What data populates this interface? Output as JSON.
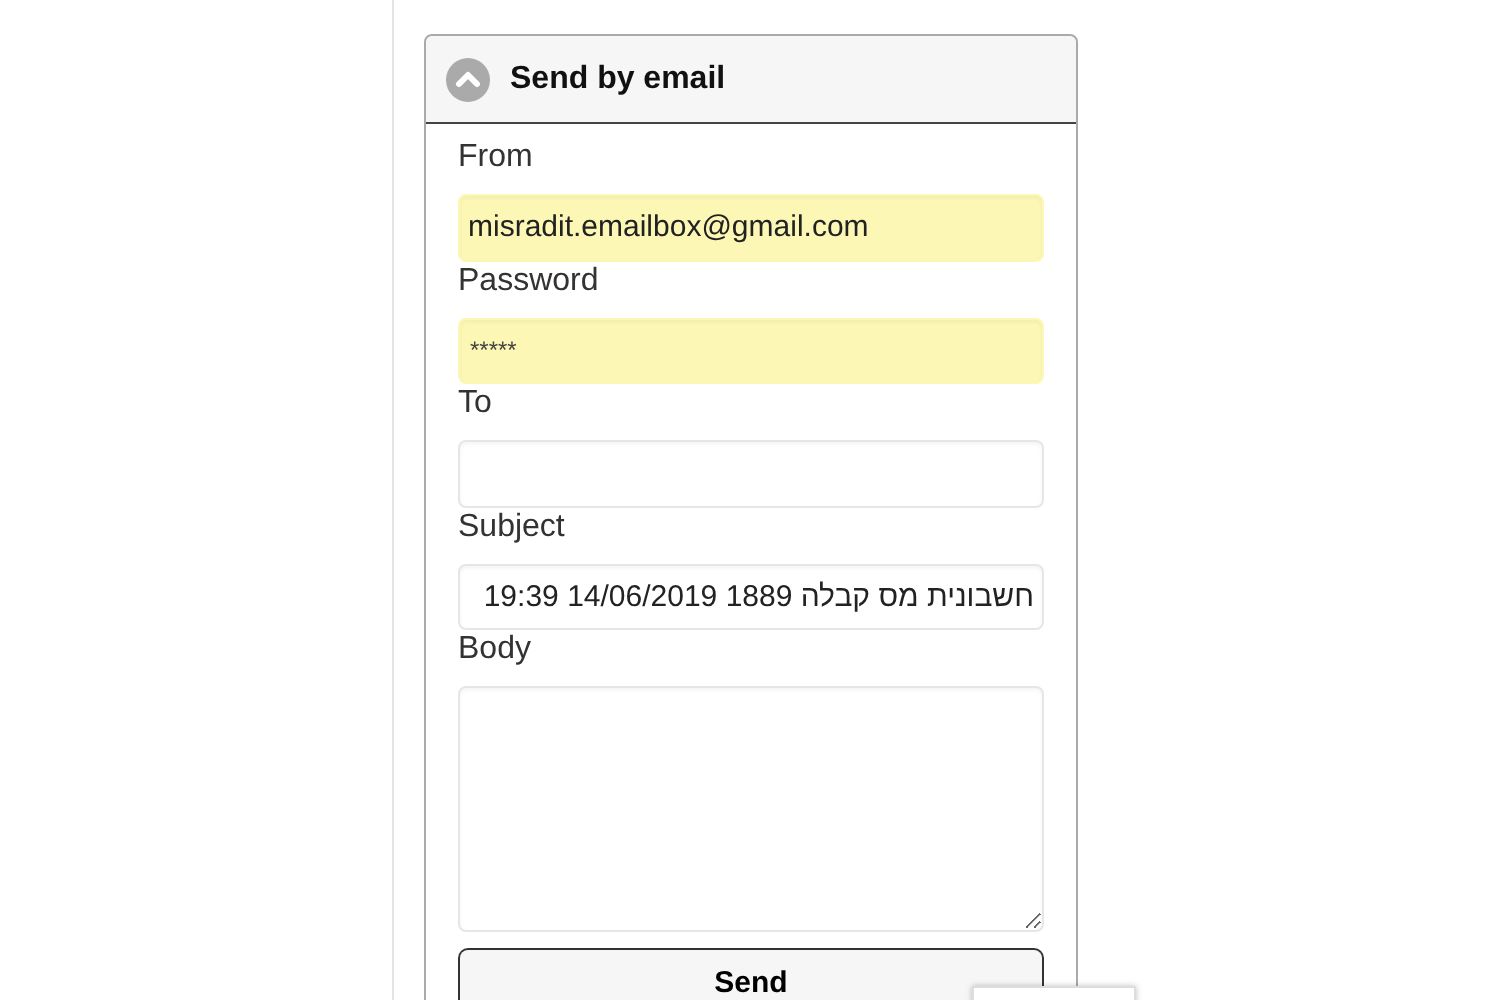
{
  "panel": {
    "title": "Send by email",
    "expanded": true
  },
  "fields": [
    {
      "kind": "input",
      "label": "From",
      "value": "misradit.emailbox@gmail.com",
      "autofilled": true
    },
    {
      "kind": "password",
      "label": "Password",
      "value": "*****",
      "autofilled": true
    },
    {
      "kind": "input",
      "label": "To",
      "autofilled": false
    },
    {
      "kind": "input",
      "label": "Subject",
      "value": "חשבונית מס קבלה 1889 14/06/2019 19:39",
      "autofilled": false
    },
    {
      "kind": "textarea",
      "label": "Body",
      "autofilled": false
    }
  ],
  "button": {
    "label": "Send"
  }
}
